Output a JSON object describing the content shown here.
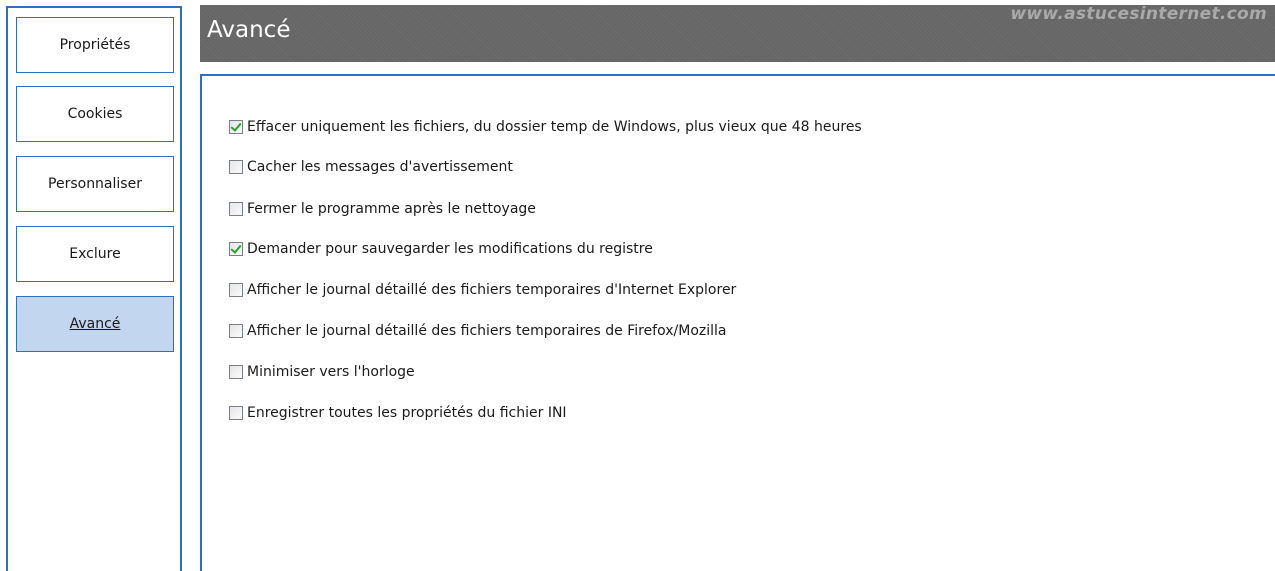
{
  "sidebar": {
    "items": [
      {
        "label": "Propriétés"
      },
      {
        "label": "Cookies"
      },
      {
        "label": "Personnaliser"
      },
      {
        "label": "Exclure"
      },
      {
        "label": "Avancé",
        "active": true
      }
    ]
  },
  "header": {
    "title": "Avancé",
    "watermark": "www.astucesinternet.com"
  },
  "options": [
    {
      "label": "Effacer uniquement les fichiers, du dossier temp de Windows, plus vieux que 48 heures",
      "checked": true
    },
    {
      "label": "Cacher les messages d'avertissement",
      "checked": false
    },
    {
      "label": "Fermer le programme après le nettoyage",
      "checked": false
    },
    {
      "label": "Demander pour sauvegarder les modifications du registre",
      "checked": true
    },
    {
      "label": "Afficher le journal détaillé des fichiers temporaires d'Internet Explorer",
      "checked": false
    },
    {
      "label": "Afficher le journal détaillé des fichiers temporaires de Firefox/Mozilla",
      "checked": false
    },
    {
      "label": "Minimiser vers l'horloge",
      "checked": false
    },
    {
      "label": "Enregistrer toutes les propriétés du fichier INI",
      "checked": false
    }
  ],
  "colors": {
    "accent_border": "#2f6fc1",
    "active_nav_bg": "#c3d6ef",
    "header_bg": "#666666",
    "check_color": "#27a327"
  }
}
